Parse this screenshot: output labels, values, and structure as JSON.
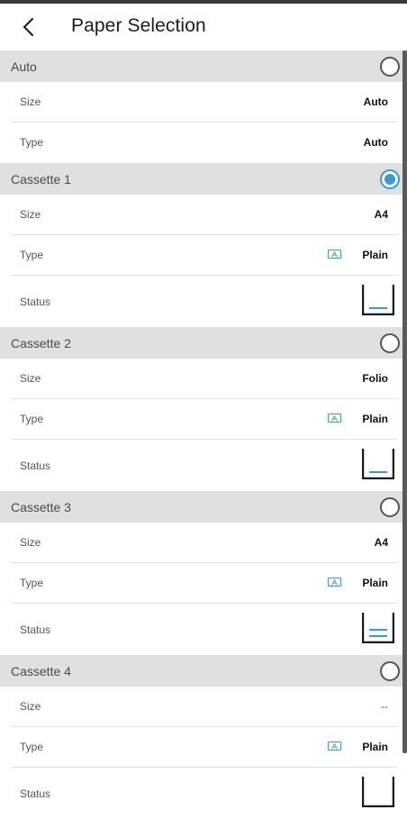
{
  "header": {
    "title": "Paper Selection"
  },
  "colors": {
    "accent": "#3a98d8",
    "section_bg": "#e0e0e0"
  },
  "sections": [
    {
      "title": "Auto",
      "selected": false,
      "rows": [
        {
          "label": "Size",
          "value": "Auto"
        },
        {
          "label": "Type",
          "value": "Auto"
        }
      ]
    },
    {
      "title": "Cassette 1",
      "selected": true,
      "rows": [
        {
          "label": "Size",
          "value": "A4"
        },
        {
          "label": "Type",
          "value": "Plain",
          "icon": "paper-type-icon"
        },
        {
          "label": "Status",
          "tray_level": 1,
          "icon": "tray-level-icon"
        }
      ]
    },
    {
      "title": "Cassette 2",
      "selected": false,
      "rows": [
        {
          "label": "Size",
          "value": "Folio"
        },
        {
          "label": "Type",
          "value": "Plain",
          "icon": "paper-type-icon"
        },
        {
          "label": "Status",
          "tray_level": 1,
          "icon": "tray-level-icon"
        }
      ]
    },
    {
      "title": "Cassette 3",
      "selected": false,
      "rows": [
        {
          "label": "Size",
          "value": "A4"
        },
        {
          "label": "Type",
          "value": "Plain",
          "icon": "paper-type-icon"
        },
        {
          "label": "Status",
          "tray_level": 2,
          "icon": "tray-level-icon"
        }
      ]
    },
    {
      "title": "Cassette 4",
      "selected": false,
      "rows": [
        {
          "label": "Size",
          "value": "--"
        },
        {
          "label": "Type",
          "value": "Plain",
          "icon": "paper-type-icon"
        },
        {
          "label": "Status",
          "tray_level": 0,
          "icon": "tray-level-icon"
        }
      ]
    }
  ]
}
